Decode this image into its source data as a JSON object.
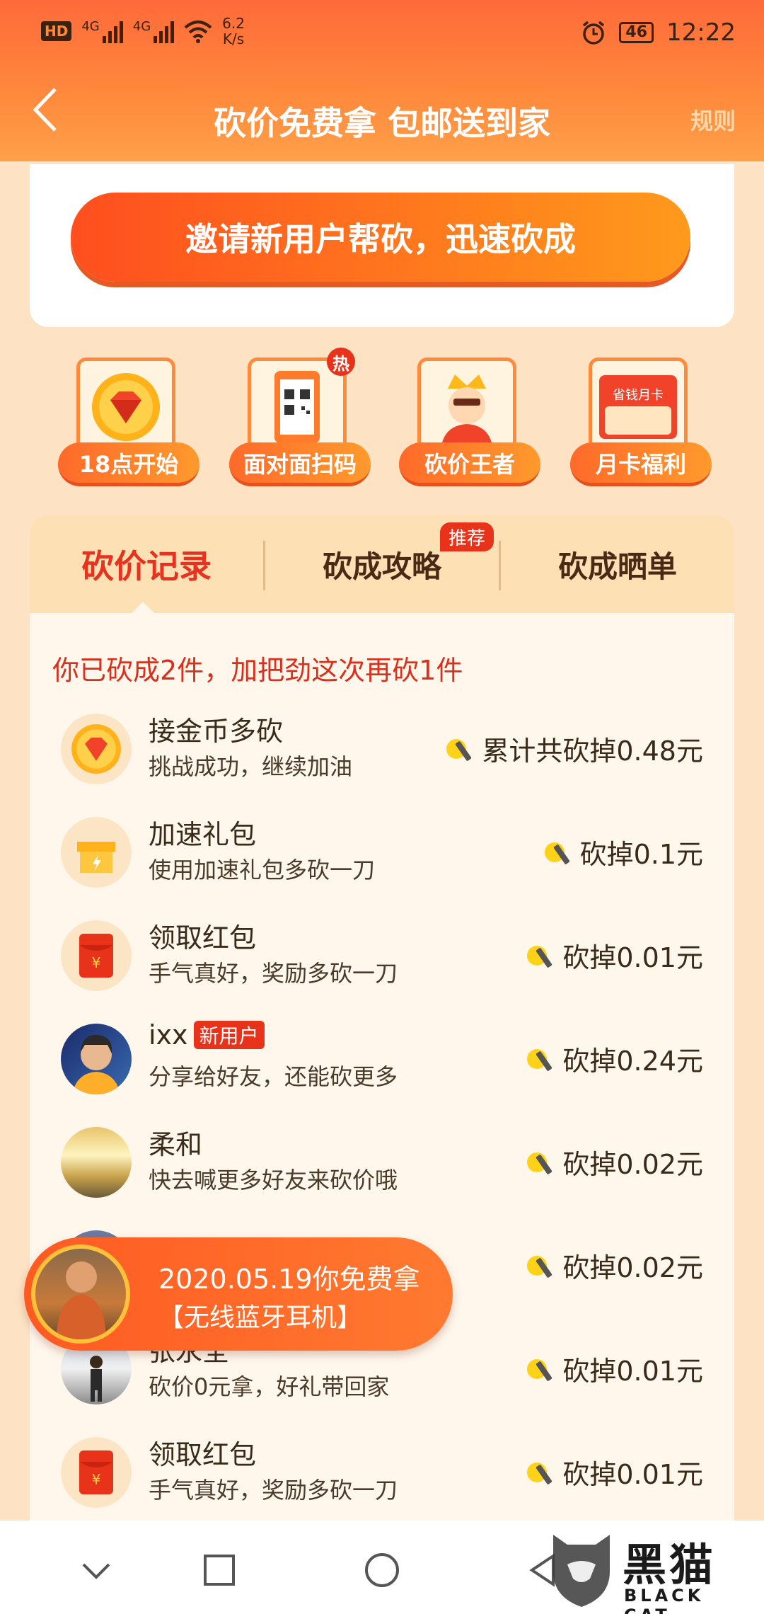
{
  "status_bar": {
    "hd": "HD",
    "net1": "4G",
    "net2": "4G",
    "speed_value": "6.2",
    "speed_unit": "K/s",
    "battery": "46",
    "time": "12:22"
  },
  "header": {
    "title": "砍价免费拿 包邮送到家",
    "rules": "规则"
  },
  "invite_button": "邀请新用户帮砍，迅速砍成",
  "features": [
    {
      "label": "18点开始",
      "icon": "diamond-coin-icon"
    },
    {
      "label": "面对面扫码",
      "icon": "qr-phone-icon",
      "badge": "热"
    },
    {
      "label": "砍价王者",
      "icon": "king-icon"
    },
    {
      "label": "月卡福利",
      "icon": "monthly-card-icon",
      "card_text": "省钱月卡"
    }
  ],
  "tabs": [
    {
      "label": "砍价记录",
      "active": true
    },
    {
      "label": "砍成攻略",
      "badge": "推荐"
    },
    {
      "label": "砍成晒单"
    }
  ],
  "summary": "你已砍成2件，加把劲这次再砍1件",
  "records": [
    {
      "name": "接金币多砍",
      "desc": "挑战成功，继续加油",
      "amount": "累计共砍掉0.48元",
      "avatar": "diamond-coin-icon"
    },
    {
      "name": "加速礼包",
      "desc": "使用加速礼包多砍一刀",
      "amount": "砍掉0.1元",
      "avatar": "gift-box-icon"
    },
    {
      "name": "领取红包",
      "desc": "手气真好，奖励多砍一刀",
      "amount": "砍掉0.01元",
      "avatar": "red-envelope-icon"
    },
    {
      "name": "ixx",
      "badge": "新用户",
      "desc": "分享给好友，还能砍更多",
      "amount": "砍掉0.24元",
      "avatar": "user-avatar"
    },
    {
      "name": "柔和",
      "desc": "快去喊更多好友来砍价哦",
      "amount": "砍掉0.02元",
      "avatar": "user-avatar"
    },
    {
      "name": "",
      "desc": "",
      "amount": "砍掉0.02元",
      "avatar": "user-avatar"
    },
    {
      "name": "张永全",
      "desc": "砍价0元拿，好礼带回家",
      "amount": "砍掉0.01元",
      "avatar": "user-avatar"
    },
    {
      "name": "领取红包",
      "desc": "手气真好，奖励多砍一刀",
      "amount": "砍掉0.01元",
      "avatar": "red-envelope-icon"
    }
  ],
  "popup": {
    "line1": "2020.05.19你免费拿",
    "line2": "【无线蓝牙耳机】"
  },
  "watermark": {
    "title": "黑猫",
    "subtitle": "BLACK CAT"
  },
  "colors": {
    "brand_orange": "#ff6a3a",
    "accent_red": "#e6331f",
    "background": "#fde3c4"
  }
}
